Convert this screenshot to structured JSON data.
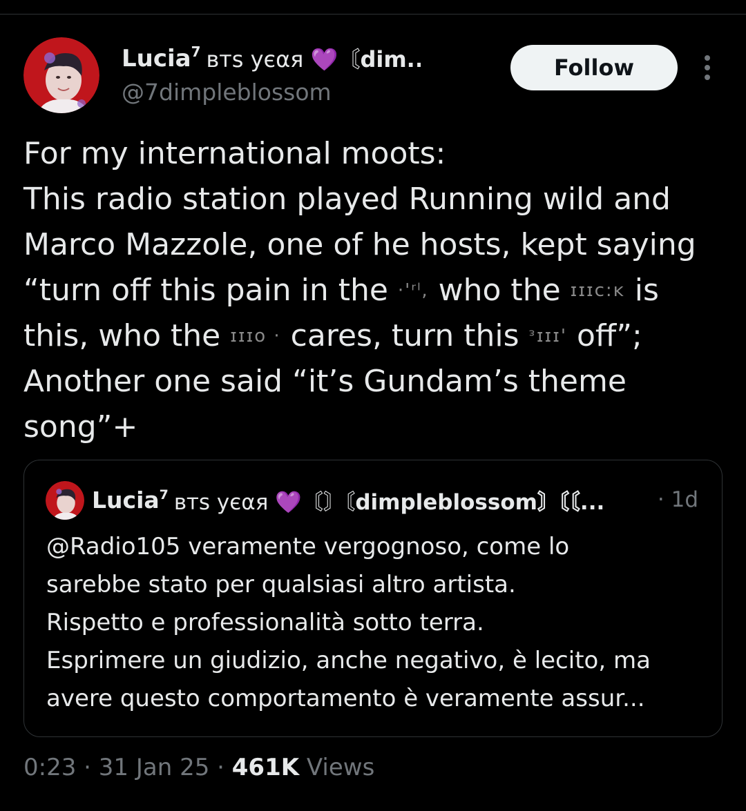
{
  "author": {
    "display_name": "Lucia",
    "display_name_sup": "7",
    "name_suffix_prefix": "ʙᴛs уєαя 💜〘",
    "name_suffix_bold": "dim...",
    "handle": "@7dimpleblossom",
    "avatar": "avatar-photo"
  },
  "actions": {
    "follow_label": "Follow",
    "more_icon": "more-vertical-icon"
  },
  "tweet": {
    "lines": [
      "For my international moots:",
      "This radio station played Running wild and",
      "Marco Mazzole, one of he hosts, kept saying",
      "“turn off this pain in the",
      "who the",
      "is",
      "this, who the",
      "cares, turn this",
      "off”;",
      "Another one said “it’s Gundam’s theme",
      "song”+"
    ],
    "censored": [
      "·'ʳˡ,",
      "ɪɪɪᴄ:ᴋ",
      "ɪɪɪᴏ ·",
      "ᵌɪɪɪ'"
    ]
  },
  "quote": {
    "display_name": "Lucia",
    "display_name_sup": "7",
    "name_suffix_prefix": "ʙᴛs уєαя 💜〘〙〘",
    "name_suffix_bold": "dimpleblossom〙〘〘...",
    "time": "· 1d",
    "lines": [
      "@Radio105 veramente vergognoso, come lo",
      "sarebbe stato per qualsiasi altro artista.",
      "Rispetto e professionalità sotto terra.",
      "Esprimere un giudizio, anche negativo, è lecito, ma",
      "avere questo comportamento è veramente assur..."
    ]
  },
  "meta": {
    "time_date": "0:23 · 31 Jan 25 ·",
    "views_count": "461K",
    "views_label": "Views"
  },
  "colors": {
    "background": "#000000",
    "text": "#e7e9ea",
    "muted": "#71767b",
    "border": "#2f3336",
    "follow_bg": "#eff3f4"
  }
}
